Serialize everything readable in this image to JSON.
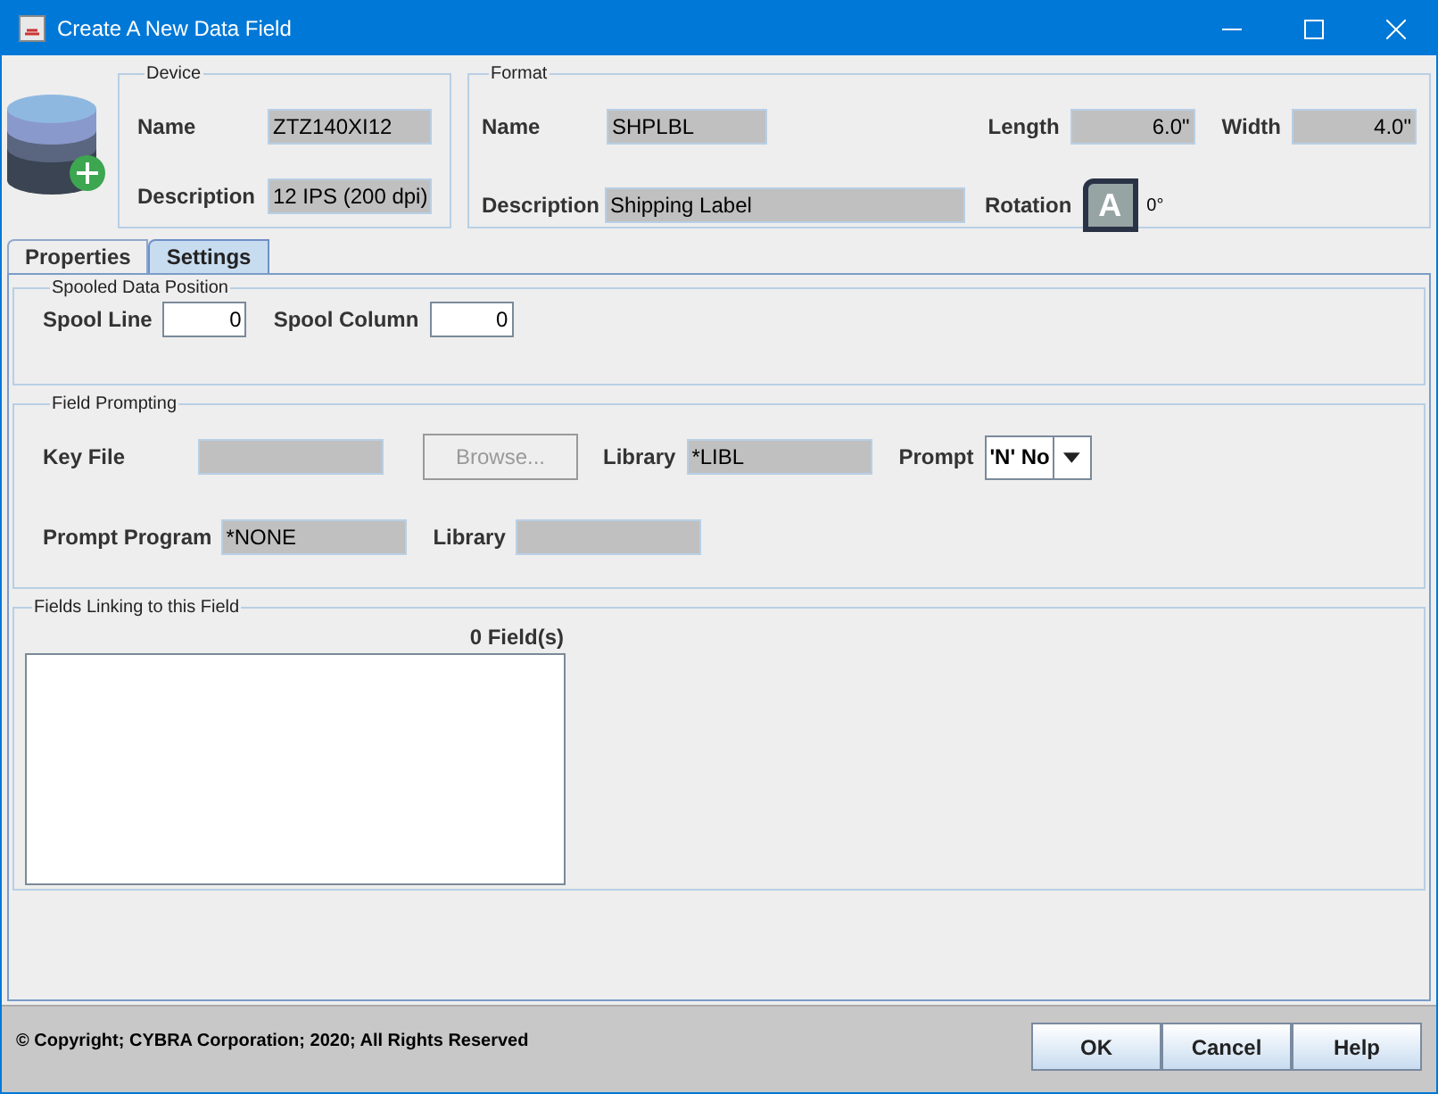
{
  "window": {
    "title": "Create A New Data Field"
  },
  "device": {
    "title": "Device",
    "fields": [
      {
        "label": "Name",
        "value": "ZTZ140XI12"
      },
      {
        "label": "Description",
        "value": "12 IPS (200 dpi)"
      }
    ]
  },
  "format": {
    "title": "Format",
    "name_label": "Name",
    "name_value": "SHPLBL",
    "length_label": "Length",
    "length_value": "6.0\"",
    "width_label": "Width",
    "width_value": "4.0\"",
    "description_label": "Description",
    "description_value": "Shipping Label",
    "rotation_label": "Rotation",
    "rotation_glyph": "A",
    "rotation_value": "0°"
  },
  "tabs": [
    {
      "label": "Properties",
      "selected": false
    },
    {
      "label": "Settings",
      "selected": true
    }
  ],
  "spool": {
    "title": "Spooled Data Position",
    "line_label": "Spool Line",
    "line_value": "0",
    "column_label": "Spool Column",
    "column_value": "0"
  },
  "prompting": {
    "title": "Field Prompting",
    "key_file_label": "Key File",
    "browse": {
      "label": "Browse...",
      "disabled": true
    },
    "library_label": "Library",
    "library_value": "*LIBL",
    "prompt_label": "Prompt",
    "prompt_value": "'N' No",
    "program_label": "Prompt Program",
    "program_value": "*NONE",
    "library2_label": "Library"
  },
  "linking": {
    "title": "Fields Linking to this Field",
    "count": "0 Field(s)"
  },
  "footer": {
    "copyright": "© Copyright; CYBRA Corporation; 2020; All Rights Reserved",
    "buttons": [
      "OK",
      "Cancel",
      "Help"
    ]
  }
}
